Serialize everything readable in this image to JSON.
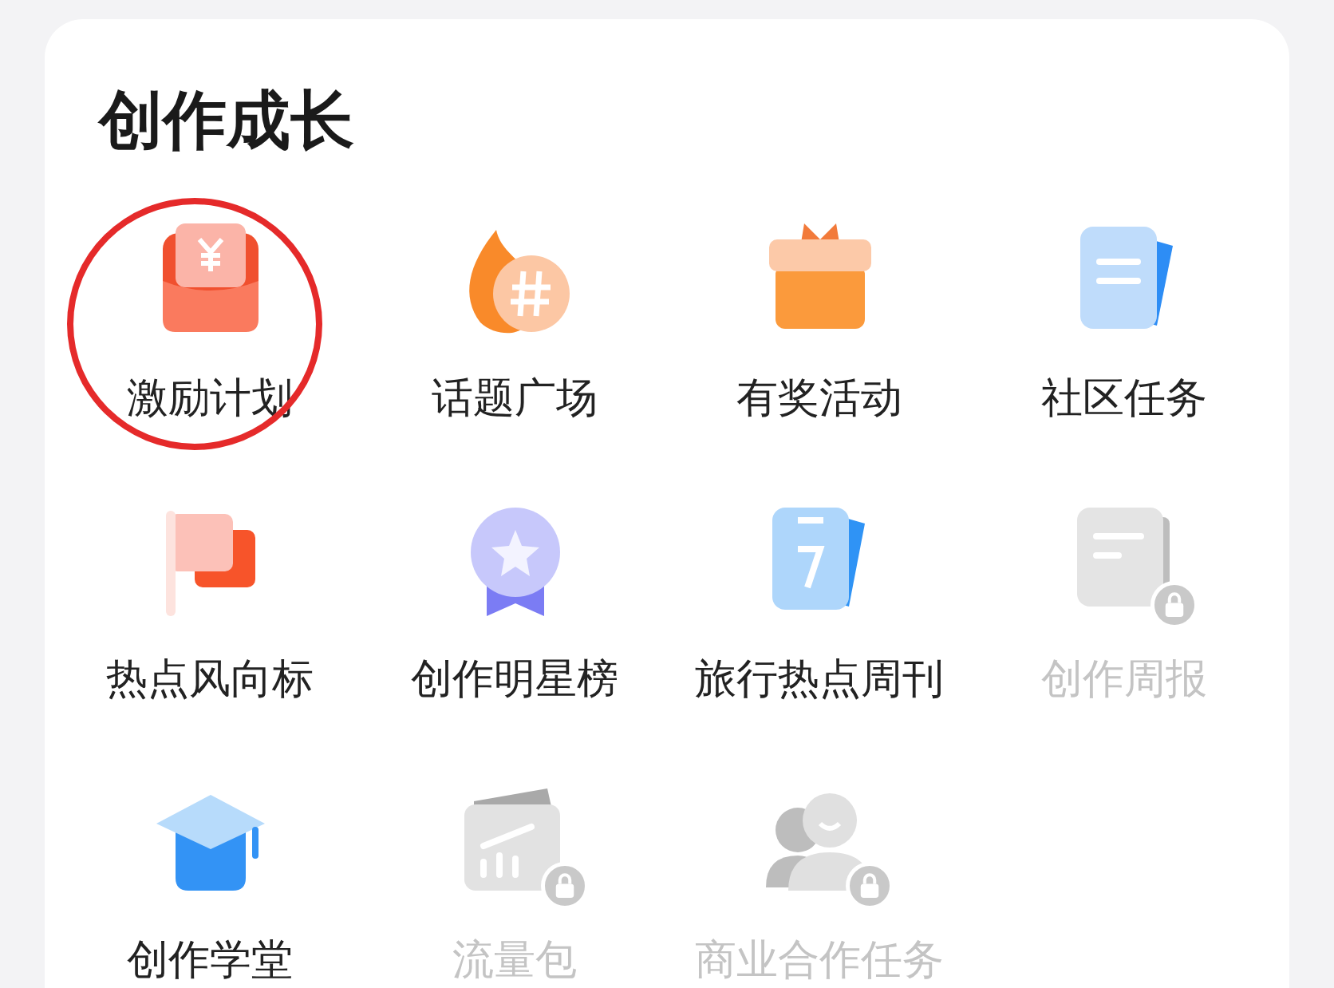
{
  "section": {
    "title": "创作成长"
  },
  "items": [
    {
      "label": "激励计划",
      "kind": "red-envelope",
      "locked": false,
      "circled": true
    },
    {
      "label": "话题广场",
      "kind": "topic",
      "locked": false,
      "circled": false
    },
    {
      "label": "有奖活动",
      "kind": "gift",
      "locked": false,
      "circled": false
    },
    {
      "label": "社区任务",
      "kind": "task",
      "locked": false,
      "circled": false
    },
    {
      "label": "热点风向标",
      "kind": "flag",
      "locked": false,
      "circled": false
    },
    {
      "label": "创作明星榜",
      "kind": "medal",
      "locked": false,
      "circled": false
    },
    {
      "label": "旅行热点周刊",
      "kind": "calendar",
      "locked": false,
      "circled": false
    },
    {
      "label": "创作周报",
      "kind": "report",
      "locked": true,
      "circled": false
    },
    {
      "label": "创作学堂",
      "kind": "graduation",
      "locked": false,
      "circled": false
    },
    {
      "label": "流量包",
      "kind": "traffic",
      "locked": true,
      "circled": false
    },
    {
      "label": "商业合作任务",
      "kind": "business",
      "locked": true,
      "circled": false
    }
  ]
}
